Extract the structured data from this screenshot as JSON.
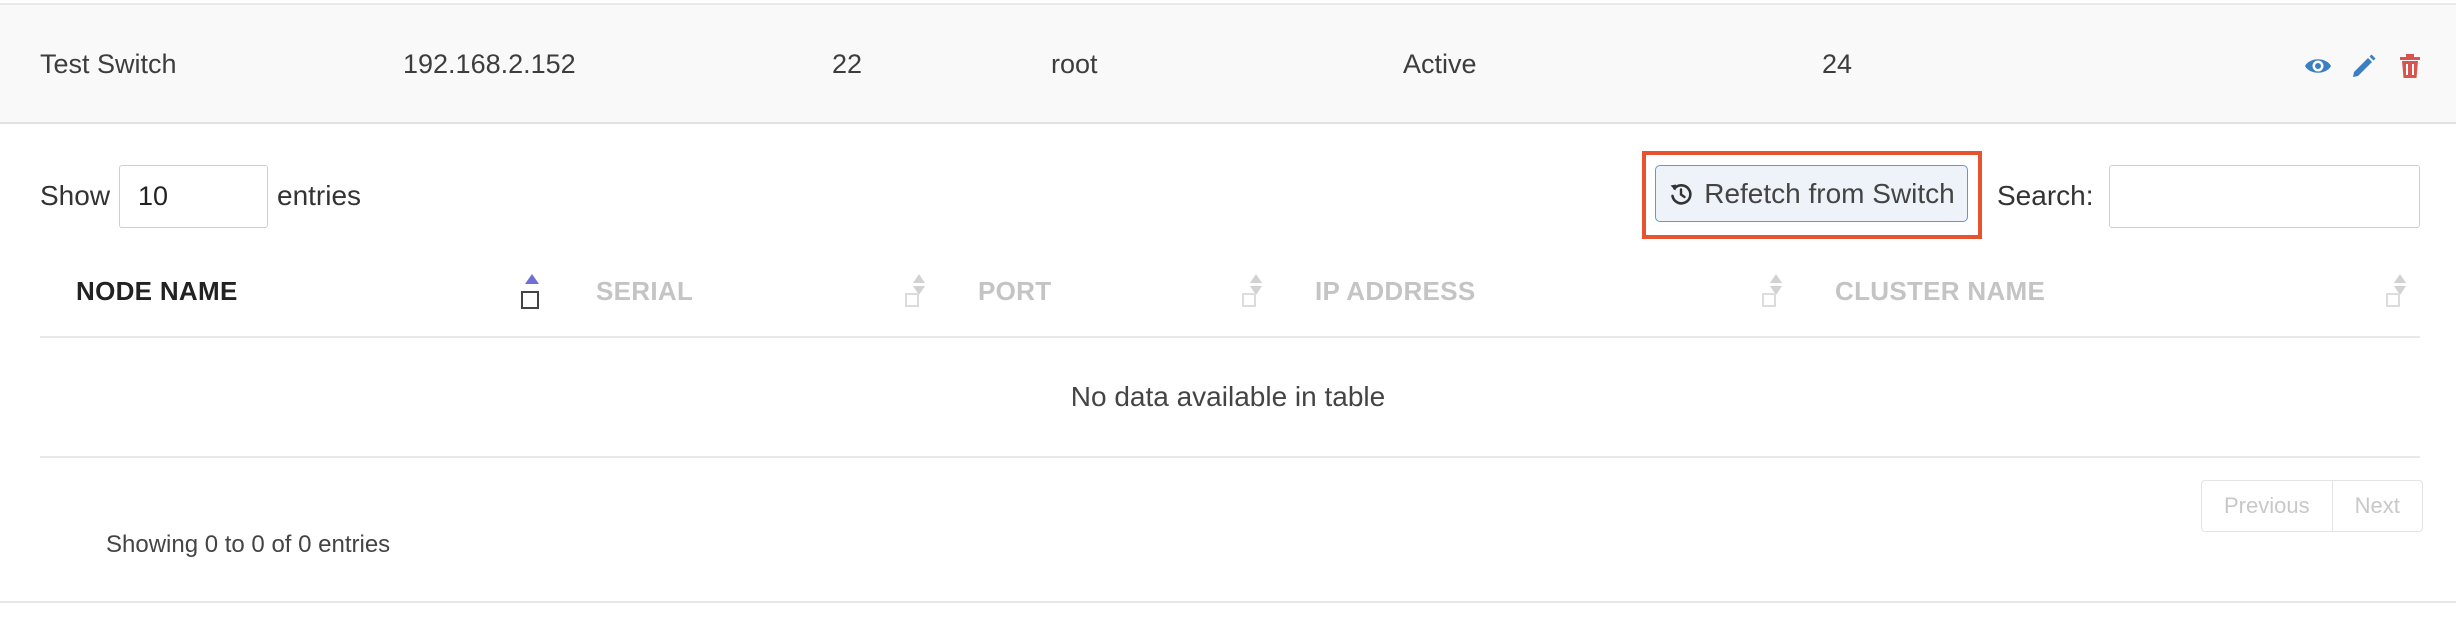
{
  "switch_row": {
    "name": "Test Switch",
    "ip": "192.168.2.152",
    "port": "22",
    "user": "root",
    "status": "Active",
    "count": "24",
    "actions": [
      "eye-icon",
      "pencil-icon",
      "trash-icon"
    ]
  },
  "table_controls": {
    "show_label": "Show",
    "length_value": "10",
    "entries_label": "entries",
    "refetch_label": "Refetch from Switch",
    "search_label": "Search:",
    "search_value": ""
  },
  "table": {
    "columns": [
      "NODE NAME",
      "SERIAL",
      "PORT",
      "IP ADDRESS",
      "CLUSTER NAME"
    ],
    "sorted_column": "NODE NAME",
    "empty_message": "No data available in table",
    "info": "Showing 0 to 0 of 0 entries"
  },
  "pagination": {
    "previous_label": "Previous",
    "next_label": "Next"
  },
  "colors": {
    "highlight_border": "#e8532f",
    "button_border": "#5b9bd5",
    "view_icon": "#3a7fc2",
    "edit_icon": "#3a7fc2",
    "delete_icon": "#d9534f",
    "sort_active": "#6f6fd8"
  }
}
